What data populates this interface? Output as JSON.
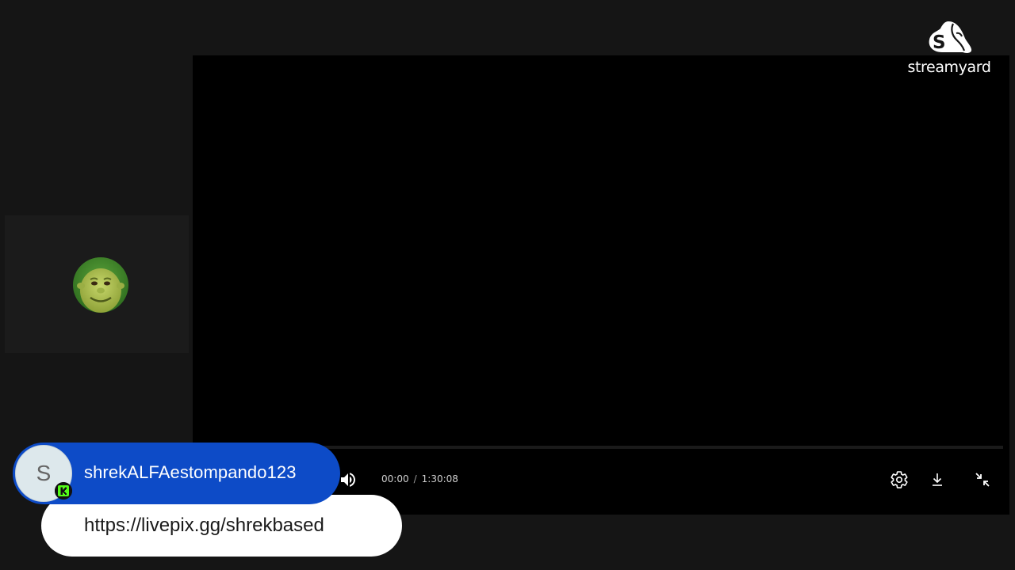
{
  "brand": {
    "logo_icon": "streamyard-logo-icon",
    "name": "streamyard"
  },
  "participant": {
    "avatar_icon": "participant-avatar-icon"
  },
  "player": {
    "current_time": "00:00",
    "time_separator": "/",
    "duration": "1:30:08",
    "progress": 0,
    "icons": {
      "volume": "volume-icon",
      "settings": "gear-icon",
      "download": "download-icon",
      "exit_fullscreen": "exit-fullscreen-icon"
    }
  },
  "comment": {
    "avatar_initial": "S",
    "platform_icon": "kick-icon",
    "author": "shrekALFAestompando123",
    "text": "https://livepix.gg/shrekbased",
    "colors": {
      "header": "#0d4bc7",
      "body": "#ffffff",
      "platform": "#53fc18"
    }
  },
  "colors": {
    "background": "#151515",
    "video": "#000000"
  }
}
